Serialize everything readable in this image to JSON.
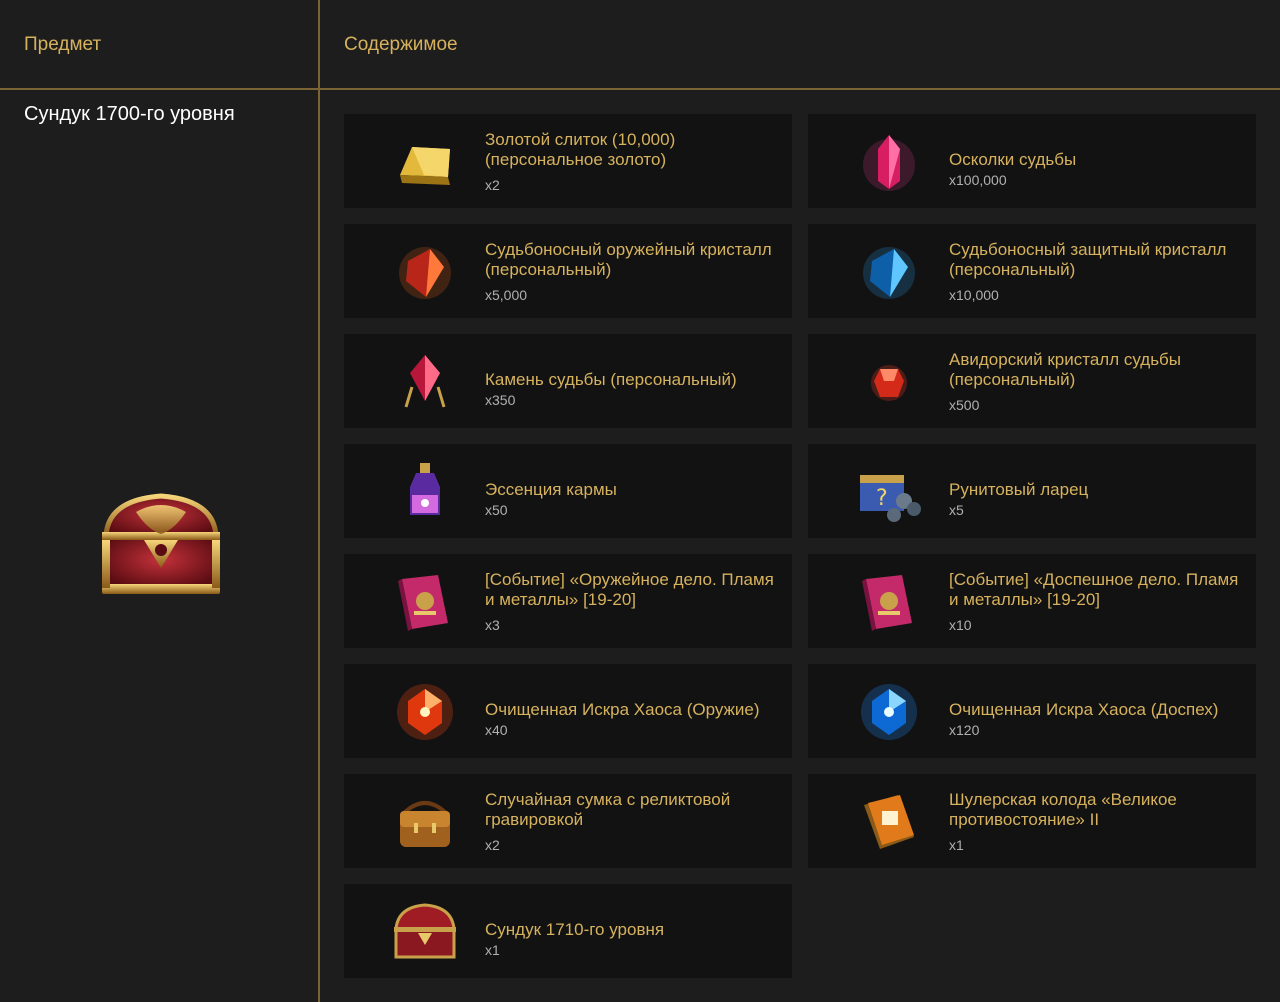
{
  "header": {
    "col_item": "Предмет",
    "col_contents": "Содержимое"
  },
  "chest_name": "Сундук 1700-го уровня",
  "items": [
    {
      "name": "Золотой слиток (10,000) (персональное золото)",
      "qty": "x2",
      "icon": "gold-bar-icon"
    },
    {
      "name": "Осколки судьбы",
      "qty": "x100,000",
      "icon": "pink-crystal-icon"
    },
    {
      "name": "Судьбоносный оружейный кристалл (персональный)",
      "qty": "x5,000",
      "icon": "red-crystal-icon"
    },
    {
      "name": "Судьбоносный защитный кристалл (персональный)",
      "qty": "x10,000",
      "icon": "blue-crystal-icon"
    },
    {
      "name": "Камень судьбы (персональный)",
      "qty": "x350",
      "icon": "fate-stone-icon"
    },
    {
      "name": "Авидорский кристалл судьбы (персональный)",
      "qty": "x500",
      "icon": "ruby-gem-icon"
    },
    {
      "name": "Эссенция кармы",
      "qty": "x50",
      "icon": "potion-icon"
    },
    {
      "name": "Рунитовый ларец",
      "qty": "x5",
      "icon": "rune-box-icon"
    },
    {
      "name": "[Событие] «Оружейное дело. Пламя и металлы» [19-20]",
      "qty": "x3",
      "icon": "book-icon"
    },
    {
      "name": "[Событие] «Доспешное дело. Пламя и металлы» [19-20]",
      "qty": "x10",
      "icon": "book-icon"
    },
    {
      "name": "Очищенная Искра Хаоса (Оружие)",
      "qty": "x40",
      "icon": "red-spark-icon"
    },
    {
      "name": "Очищенная Искра Хаоса (Доспех)",
      "qty": "x120",
      "icon": "blue-spark-icon"
    },
    {
      "name": "Случайная сумка с реликтовой гравировкой",
      "qty": "x2",
      "icon": "bag-icon"
    },
    {
      "name": "Шулерская колода «Великое противостояние» II",
      "qty": "x1",
      "icon": "card-deck-icon"
    },
    {
      "name": "Сундук 1710-го уровня",
      "qty": "x1",
      "icon": "chest-icon"
    }
  ],
  "colors": {
    "gold_text": "#d6b25e",
    "divider": "#7a6433",
    "card_bg": "#121212",
    "page_bg": "#1d1d1d"
  }
}
